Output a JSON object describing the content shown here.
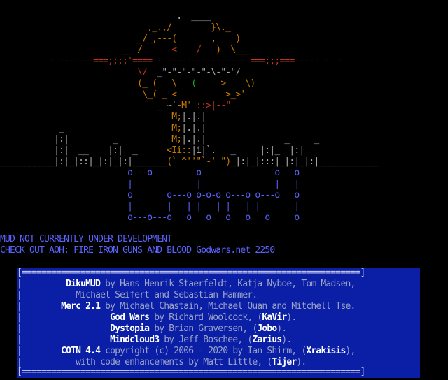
{
  "notice": {
    "line1": "MUD NOT CURRENTLY UNDER DEVELOPMENT",
    "line2": "CHECK OUT AOH: FIRE IRON GUNS AND BLOOD Godwars.net 2250"
  },
  "credits": {
    "rows": [
      {
        "name": "DikuMUD",
        "text": " by Hans Henrik Staerfeldt, Katja Nyboe, Tom Madsen,"
      },
      {
        "name": "",
        "text": "Michael Seifert and Sebastian Hammer."
      },
      {
        "name": "Merc 2.1",
        "text": " by Michael Chastain, Michael Quan and Mitchell Tse."
      },
      {
        "name": "God Wars",
        "text": " by Richard Woolcock, (",
        "handle": "KaVir",
        "tail": ")."
      },
      {
        "name": "Dystopia",
        "text": " by Brian Graversen, (",
        "handle": "Jobo",
        "tail": ")."
      },
      {
        "name": "Mindcloud3",
        "text": " by Jeff Boschee, (",
        "handle": "Zarius",
        "tail": ")."
      },
      {
        "name": "COTN 4.4",
        "text": " copyright (c) 2006 - 2020 by Ian Shirm, (",
        "handle": "Xrakisis",
        "tail": "),"
      },
      {
        "name": "",
        "text": "with code enhancements by Matt Little, (",
        "handle": "Tijer",
        "tail": ")."
      }
    ]
  },
  "colors": {
    "background": "#000000",
    "notice": "#5b63ff",
    "credits_bg": "#0a1fa6",
    "art_orange": "#c87a00",
    "art_red": "#c4361c",
    "art_gray": "#aaaaaa"
  }
}
